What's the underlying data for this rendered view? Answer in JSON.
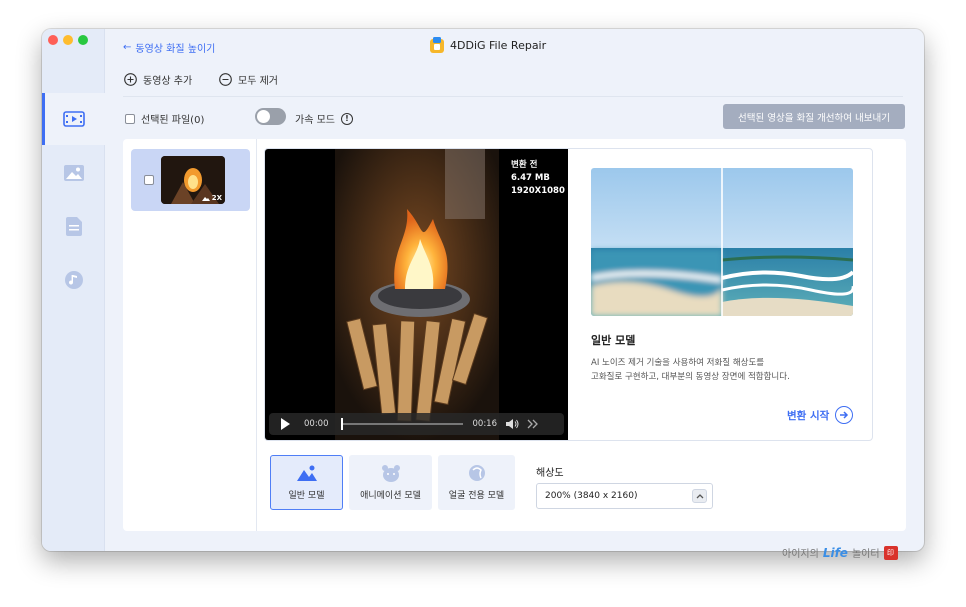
{
  "app": {
    "title": "4DDiG File Repair",
    "back_label": "동영상 화질 높이기"
  },
  "toolbar": {
    "add_video": "동영상 추가",
    "remove_all": "모두 제거"
  },
  "sidebar": {
    "items": [
      {
        "name": "video",
        "icon": "video-enhance-icon",
        "active": true
      },
      {
        "name": "photo",
        "icon": "image-icon",
        "active": false
      },
      {
        "name": "document",
        "icon": "document-icon",
        "active": false
      },
      {
        "name": "audio",
        "icon": "music-icon",
        "active": false
      }
    ]
  },
  "controls": {
    "selected_files": "선택된 파일(0)",
    "accel_mode": "가속 모드",
    "accel_enabled": false,
    "export_button": "선택된 영상을 화질 개선하여 내보내기"
  },
  "files": [
    {
      "badge": "2X",
      "checked": false
    }
  ],
  "preview": {
    "info_title": "변환 전",
    "file_size": "6.47 MB",
    "resolution": "1920X1080",
    "time_current": "00:00",
    "time_total": "00:16",
    "progress": 0
  },
  "model": {
    "title": "일반 모델",
    "desc_line1": "AI 노이즈 제거 기술을 사용하여 저화질 해상도를",
    "desc_line2": "고화질로 구현하고, 대부분의 동영상 장면에 적합합니다.",
    "start_button": "변환 시작"
  },
  "models": [
    {
      "label": "일반 모델",
      "icon": "general-model-icon",
      "selected": true
    },
    {
      "label": "애니메이션 모델",
      "icon": "animation-model-icon",
      "selected": false
    },
    {
      "label": "얼굴 전용 모델",
      "icon": "face-model-icon",
      "selected": false
    }
  ],
  "resolution": {
    "label": "해상도",
    "value": "200% (3840 x 2160)"
  },
  "watermark": {
    "prefix": "아이지의",
    "life": "Life",
    "suffix": "놀이터"
  },
  "colors": {
    "accent": "#3e6ef3",
    "export_disabled": "#a4adbf",
    "sidebar_bg": "#e4ebf8"
  }
}
